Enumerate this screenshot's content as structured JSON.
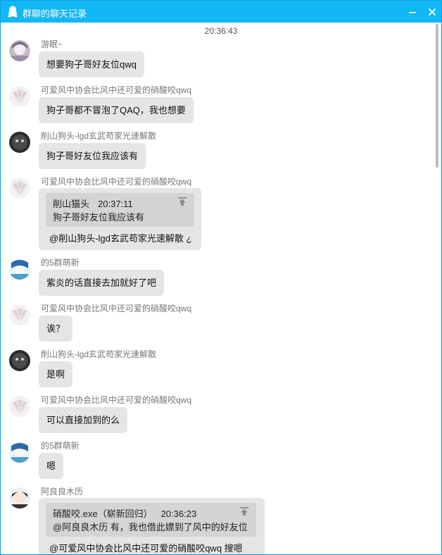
{
  "window": {
    "title": "群聊的聊天记录"
  },
  "timestamp": "20:36:43",
  "messages": [
    {
      "sender": "游眠~",
      "text": "想要狗子哥好友位qwq"
    },
    {
      "sender": "可爱风中协会比风中还可爱的硝酸咬qwq",
      "text": "狗子哥都不冒泡了QAQ，我也想要"
    },
    {
      "sender": "削山狗头-lgd玄武苟家光速解散",
      "text": "狗子哥好友位我应该有"
    },
    {
      "sender": "可爱风中协会比风中还可爱的硝酸咬qwq",
      "quote_author": "削山猫头",
      "quote_time": "20:37:11",
      "quote_text": "狗子哥好友位我应该有",
      "text": "@削山狗头-lgd玄武苟家光速解散 ¿"
    },
    {
      "sender": "的5群萌新",
      "text": "紫炎的话直接去加就好了吧"
    },
    {
      "sender": "可爱风中协会比风中还可爱的硝酸咬qwq",
      "text": "诶？"
    },
    {
      "sender": "削山狗头-lgd玄武苟家光速解散",
      "text": "是啊"
    },
    {
      "sender": "可爱风中协会比风中还可爱的硝酸咬qwq",
      "text": "可以直接加到的么"
    },
    {
      "sender": "的5群萌新",
      "text": "嗯"
    },
    {
      "sender": "阿良良木历",
      "quote_author": "硝酸咬.exe（崭新回归）",
      "quote_time": "20:36:23",
      "quote_text": "@阿良良木历 有，我也借此嫖到了风中的好友位",
      "text": "@可爱风中协会比风中还可爱的硝酸咬qwq 搜嗯"
    }
  ],
  "colors": {
    "titlebar": "#12b7f5",
    "bubble": "#e5e5e5",
    "quote": "#d4d4d4"
  }
}
